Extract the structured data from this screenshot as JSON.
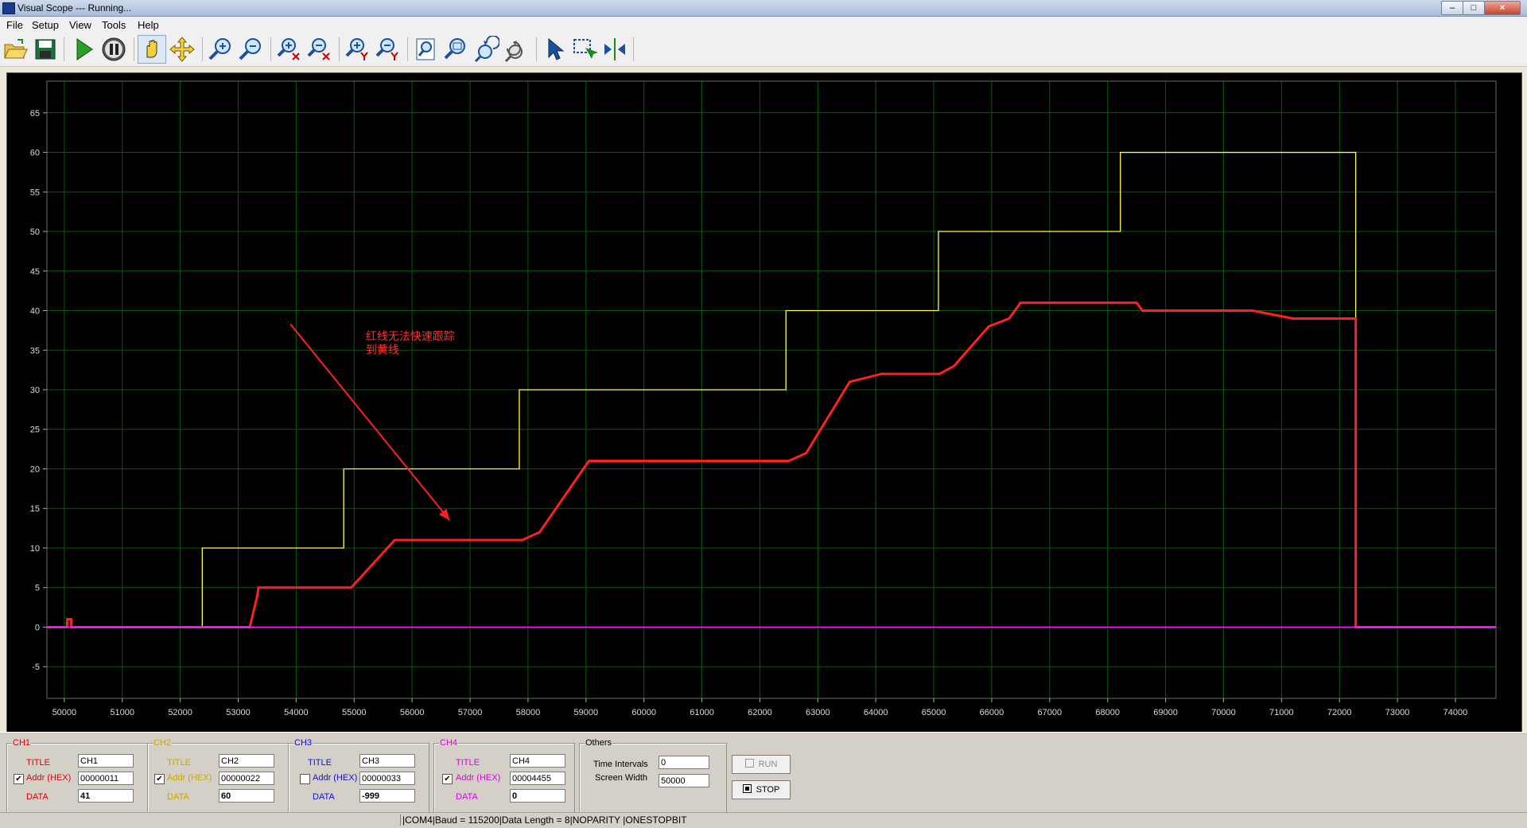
{
  "window": {
    "title": "Visual Scope  ---  Running..."
  },
  "menu": [
    "File",
    "Setup",
    "View",
    "Tools",
    "Help"
  ],
  "toolbar": {
    "buttons": [
      "open-icon",
      "save-icon",
      "run-icon",
      "pause-icon",
      "hand-icon",
      "move-icon",
      "zoom-in-icon",
      "zoom-out-icon",
      "zoom-in-x-icon",
      "zoom-out-x-icon",
      "zoom-in-y-icon",
      "zoom-out-y-icon",
      "zoom-fit-icon",
      "zoom-rect-icon",
      "undo-zoom-icon",
      "redo-zoom-icon",
      "pointer-icon",
      "select-rect-icon",
      "cursor-marker-icon"
    ]
  },
  "colors": {
    "ch1": "#ff2020",
    "ch2": "#ffff40",
    "ch3": "#3030ff",
    "ch4": "#ff20ff",
    "grid": "#0a5a0a",
    "background": "#000000"
  },
  "chart_data": {
    "type": "line",
    "xlim": [
      49700,
      74700
    ],
    "ylim": [
      -9,
      69
    ],
    "x_ticks": [
      50000,
      51000,
      52000,
      53000,
      54000,
      55000,
      56000,
      57000,
      58000,
      59000,
      60000,
      61000,
      62000,
      63000,
      64000,
      65000,
      66000,
      67000,
      68000,
      69000,
      70000,
      71000,
      72000,
      73000,
      74000
    ],
    "y_ticks": [
      -5,
      0,
      5,
      10,
      15,
      20,
      25,
      30,
      35,
      40,
      45,
      50,
      55,
      60,
      65
    ],
    "grid": true,
    "series": [
      {
        "name": "CH2",
        "color": "#ffff40",
        "x": [
          49700,
          52380,
          52380,
          54820,
          54820,
          57850,
          57850,
          62450,
          62450,
          65080,
          65080,
          68220,
          68220,
          72280,
          72280,
          74700
        ],
        "y": [
          0,
          0,
          10,
          10,
          20,
          20,
          30,
          30,
          40,
          40,
          50,
          50,
          60,
          60,
          0,
          0
        ]
      },
      {
        "name": "CH1",
        "color": "#ff2020",
        "x": [
          49700,
          50050,
          50050,
          50120,
          50120,
          53200,
          53330,
          53350,
          54200,
          54950,
          55700,
          57900,
          58200,
          59050,
          62500,
          62800,
          63550,
          64100,
          65100,
          65350,
          65950,
          66300,
          66500,
          68500,
          68600,
          70500,
          71200,
          72000,
          72280,
          72280,
          74700
        ],
        "y": [
          0,
          0,
          1,
          1,
          0,
          0,
          4,
          5,
          5,
          5,
          11,
          11,
          12,
          21,
          21,
          22,
          31,
          32,
          32,
          33,
          38,
          39,
          41,
          41,
          40,
          40,
          39,
          39,
          39,
          0,
          0
        ]
      },
      {
        "name": "CH4",
        "color": "#ff20ff",
        "x": [
          49700,
          74700
        ],
        "y": [
          0,
          0
        ]
      }
    ],
    "annotation": {
      "lines": [
        "红线无法快速跟踪",
        "到黄线"
      ],
      "x": 55200,
      "y": 36.3,
      "arrow_to": [
        56650,
        13.5
      ],
      "arrow_from": [
        53900,
        38.3
      ]
    }
  },
  "channels": [
    {
      "legend": "CH1",
      "title_label": "TITLE",
      "title": "CH1",
      "addr_label": "Addr (HEX)",
      "addr": "00000011",
      "data_label": "DATA",
      "data": "41",
      "checked": "✔",
      "color": "#e00000"
    },
    {
      "legend": "CH2",
      "title_label": "TITLE",
      "title": "CH2",
      "addr_label": "Addr (HEX)",
      "addr": "00000022",
      "data_label": "DATA",
      "data": "60",
      "checked": "✔",
      "color": "#c8a800"
    },
    {
      "legend": "CH3",
      "title_label": "TITLE",
      "title": "CH3",
      "addr_label": "Addr (HEX)",
      "addr": "00000033",
      "data_label": "DATA",
      "data": "-999",
      "checked": "",
      "color": "#1010d0"
    },
    {
      "legend": "CH4",
      "title_label": "TITLE",
      "title": "CH4",
      "addr_label": "Addr (HEX)",
      "addr": "00004455",
      "data_label": "DATA",
      "data": "0",
      "checked": "✔",
      "color": "#e000e0"
    }
  ],
  "others": {
    "legend": "Others",
    "time_intervals_label": "Time Intervals",
    "time_intervals": "0",
    "screen_width_label": "Screen Width",
    "screen_width": "50000"
  },
  "buttons": {
    "run": "RUN",
    "stop": "STOP"
  },
  "status": "|COM4|Baud = 115200|Data Length = 8|NOPARITY  |ONESTOPBIT"
}
